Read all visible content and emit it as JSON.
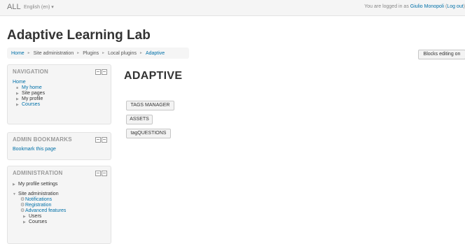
{
  "navbar": {
    "brand": "ALL",
    "language": "English (en) ▾",
    "login_prefix": "You are logged in as ",
    "user_name": "Giulio Monopoli",
    "logout_open": " (",
    "logout_label": "Log out",
    "logout_close": ")"
  },
  "header": {
    "site_title": "Adaptive Learning Lab",
    "breadcrumb": [
      "Home",
      "Site administration",
      "Plugins",
      "Local plugins",
      "Adaptive"
    ],
    "breadcrumb_sep": "►",
    "blocks_editing_button": "Blocks editing on"
  },
  "navigation_block": {
    "title": "NAVIGATION",
    "home": "Home",
    "items": [
      {
        "label": "My home",
        "bullet": "■"
      },
      {
        "label": "Site pages",
        "bullet": "▶"
      },
      {
        "label": "My profile",
        "bullet": "▶"
      },
      {
        "label": "Courses",
        "bullet": "▶"
      }
    ]
  },
  "admin_bookmarks_block": {
    "title": "ADMIN BOOKMARKS",
    "link": "Bookmark this page"
  },
  "administration_block": {
    "title": "ADMINISTRATION",
    "my_profile_settings": "My profile settings",
    "site_administration": "Site administration",
    "sub_items": [
      "Notifications",
      "Registration",
      "Advanced features"
    ],
    "folders": [
      "Users",
      "Courses"
    ]
  },
  "main": {
    "heading": "ADAPTIVE",
    "buttons": [
      "TAGS MANAGER",
      "ASSETS",
      "tagQUESTIONS"
    ]
  }
}
